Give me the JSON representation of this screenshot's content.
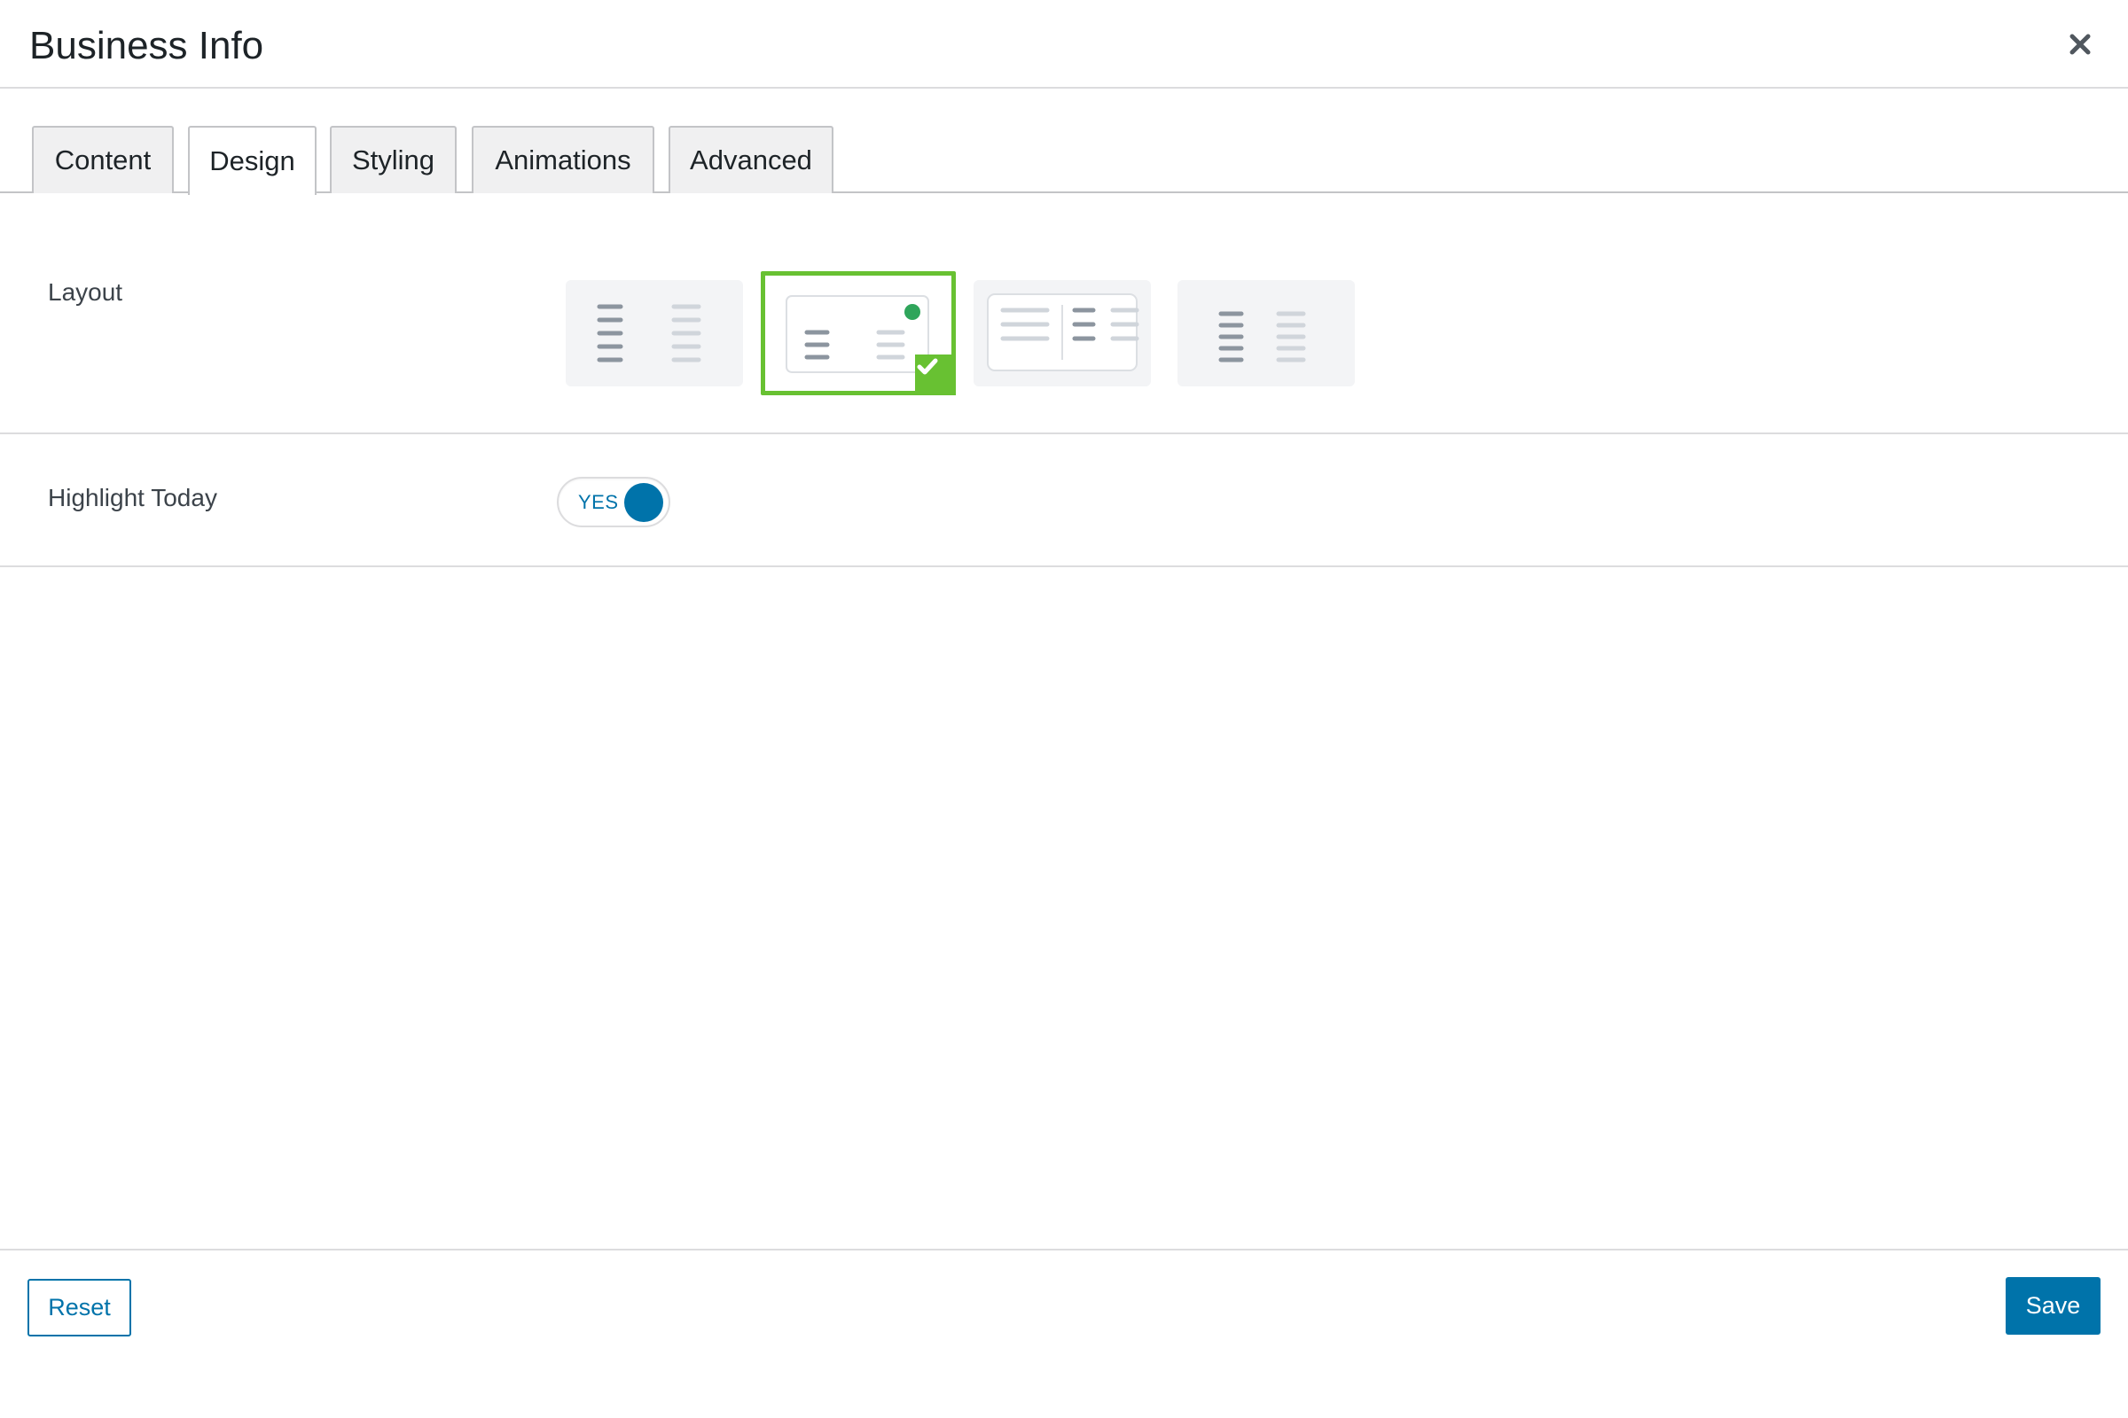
{
  "modal": {
    "title": "Business Info",
    "close_icon": "close-icon"
  },
  "tabs": [
    {
      "label": "Content",
      "active": false
    },
    {
      "label": "Design",
      "active": true
    },
    {
      "label": "Styling",
      "active": false
    },
    {
      "label": "Animations",
      "active": false
    },
    {
      "label": "Advanced",
      "active": false
    }
  ],
  "fields": {
    "layout": {
      "label": "Layout",
      "options": [
        "layout-option-1",
        "layout-option-2",
        "layout-option-3",
        "layout-option-4"
      ],
      "selected_index": 1,
      "icon": "checkmark-icon"
    },
    "highlight_today": {
      "label": "Highlight Today",
      "toggle_text": "YES",
      "value": true
    }
  },
  "footer": {
    "reset_label": "Reset",
    "save_label": "Save"
  },
  "colors": {
    "accent": "#0073aa",
    "selected_border": "#68c132",
    "dot": "#2fa55b"
  }
}
